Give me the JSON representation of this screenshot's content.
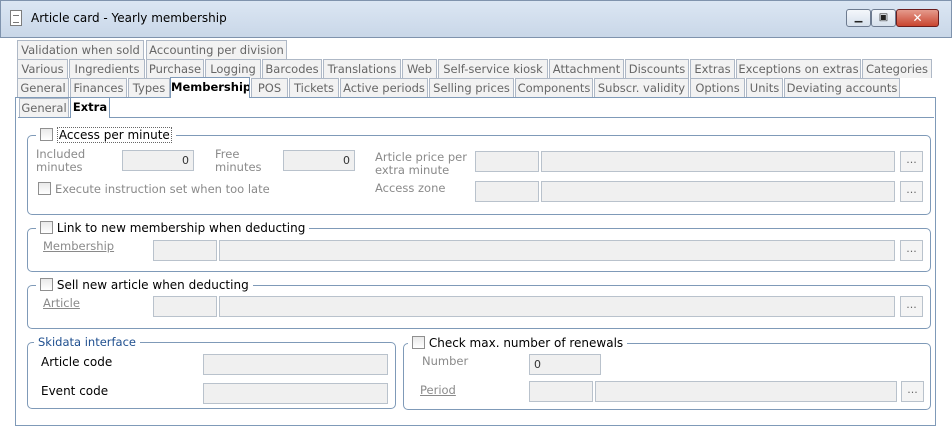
{
  "window": {
    "title": "Article card - Yearly membership",
    "minimize_glyph": "▁",
    "maximize_glyph": "▣",
    "close_glyph": "✕"
  },
  "tabs": {
    "row1": [
      "Validation when sold",
      "Accounting per division"
    ],
    "row2": [
      "Various",
      "Ingredients",
      "Purchase",
      "Logging",
      "Barcodes",
      "Translations",
      "Web",
      "Self-service kiosk",
      "Attachment",
      "Discounts",
      "Extras",
      "Exceptions on extras",
      "Categories"
    ],
    "row3": [
      "General",
      "Finances",
      "Types",
      "Membership",
      "POS",
      "Tickets",
      "Active periods",
      "Selling prices",
      "Components",
      "Subscr. validity",
      "Options",
      "Units",
      "Deviating accounts"
    ],
    "active": "Membership"
  },
  "subtabs": {
    "items": [
      "General",
      "Extra"
    ],
    "active": "Extra"
  },
  "access_per_minute": {
    "label": "Access per minute",
    "checked": false,
    "included_minutes_label": "Included minutes",
    "included_minutes_value": "0",
    "free_minutes_label": "Free minutes",
    "free_minutes_value": "0",
    "execute_label": "Execute instruction set when too late",
    "article_price_label": "Article price per extra minute",
    "access_zone_label": "Access zone",
    "ellipsis": "..."
  },
  "link_membership": {
    "label": "Link to new membership when deducting",
    "checked": false,
    "field_label": "Membership",
    "ellipsis": "..."
  },
  "sell_article": {
    "label": "Sell new article when deducting",
    "checked": false,
    "field_label": "Article",
    "ellipsis": "..."
  },
  "skidata": {
    "legend": "Skidata interface",
    "article_code_label": "Article code",
    "event_code_label": "Event code"
  },
  "renewals": {
    "label": "Check max. number of renewals",
    "checked": false,
    "number_label": "Number",
    "number_value": "0",
    "period_label": "Period",
    "ellipsis": "..."
  }
}
